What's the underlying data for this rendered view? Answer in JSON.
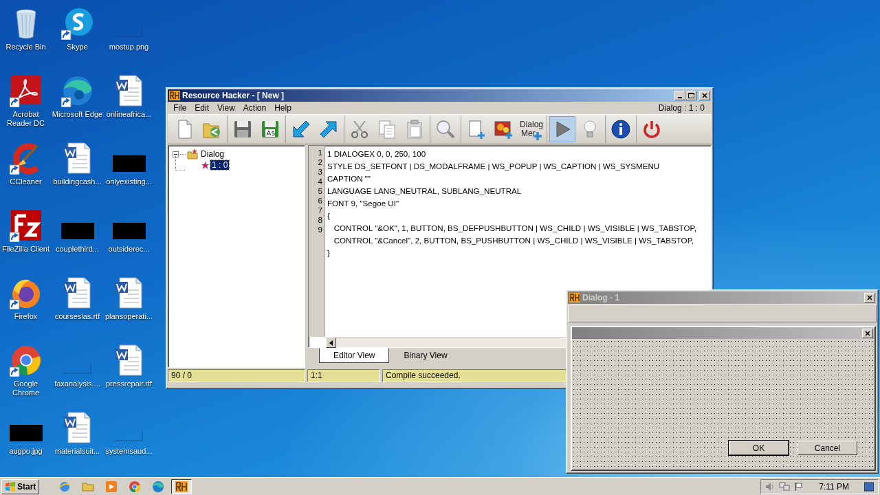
{
  "desktop_icons": [
    {
      "label": "Recycle Bin",
      "kind": "trash",
      "shortcut": false
    },
    {
      "label": "Skype",
      "kind": "chat",
      "shortcut": true
    },
    {
      "label": "mostup.png",
      "kind": "blank-thumbnail",
      "shortcut": false
    },
    {
      "label": "Acrobat Reader DC",
      "kind": "pdf",
      "shortcut": true
    },
    {
      "label": "Microsoft Edge",
      "kind": "wave",
      "shortcut": true
    },
    {
      "label": "onlineafrica...",
      "kind": "document",
      "shortcut": false
    },
    {
      "label": "CCleaner",
      "kind": "brush",
      "shortcut": true
    },
    {
      "label": "buildingcash...",
      "kind": "document",
      "shortcut": false
    },
    {
      "label": "onlyexisting...",
      "kind": "dark-thumbnail",
      "shortcut": false
    },
    {
      "label": "FileZilla Client",
      "kind": "zigzag",
      "shortcut": true
    },
    {
      "label": "couplethird...",
      "kind": "dark-thumbnail",
      "shortcut": false
    },
    {
      "label": "outsiderec...",
      "kind": "dark-thumbnail",
      "shortcut": false
    },
    {
      "label": "Firefox",
      "kind": "fox",
      "shortcut": true
    },
    {
      "label": "courseslas.rtf",
      "kind": "document",
      "shortcut": false
    },
    {
      "label": "plansoperati...",
      "kind": "document",
      "shortcut": false
    },
    {
      "label": "Google Chrome",
      "kind": "browser",
      "shortcut": true
    },
    {
      "label": "faxanalysis....",
      "kind": "blank-thumbnail",
      "shortcut": false
    },
    {
      "label": "pressrepair.rtf",
      "kind": "document",
      "shortcut": false
    },
    {
      "label": "augpo.jpg",
      "kind": "dark-thumbnail",
      "shortcut": false
    },
    {
      "label": "materialsuit...",
      "kind": "document",
      "shortcut": false
    },
    {
      "label": "systemsaud...",
      "kind": "blank-thumbnail",
      "shortcut": false
    }
  ],
  "main_window": {
    "title": "Resource Hacker - [ New ]",
    "menu": [
      "File",
      "Edit",
      "View",
      "Action",
      "Help"
    ],
    "context": "Dialog : 1 : 0",
    "toolbar": [
      [
        {
          "kind": "new",
          "selected": false
        },
        {
          "kind": "open",
          "selected": false
        }
      ],
      [
        {
          "kind": "save",
          "selected": false
        },
        {
          "kind": "save-as",
          "selected": false
        }
      ],
      [
        {
          "kind": "import",
          "selected": false
        },
        {
          "kind": "export",
          "selected": false
        }
      ],
      [
        {
          "kind": "cut",
          "selected": false
        },
        {
          "kind": "copy",
          "selected": false
        },
        {
          "kind": "paste",
          "selected": false
        }
      ],
      [
        {
          "kind": "find",
          "selected": false
        }
      ],
      [
        {
          "kind": "add-blank",
          "selected": false
        },
        {
          "kind": "add-image",
          "selected": false
        },
        {
          "kind": "merger",
          "selected": false,
          "lines": [
            "Dialog",
            "Mer"
          ]
        }
      ],
      [
        {
          "kind": "run",
          "selected": true
        },
        {
          "kind": "bulb",
          "selected": false
        }
      ],
      [
        {
          "kind": "info",
          "selected": false
        }
      ],
      [
        {
          "kind": "power",
          "selected": false
        }
      ]
    ],
    "tree": [
      {
        "label": "Dialog",
        "selected": false,
        "expanded": true,
        "children": [
          {
            "label": "1 : 0",
            "selected": true
          }
        ]
      }
    ],
    "code_lines": [
      {
        "number": "1",
        "text": "1 DIALOGEX 0, 0, 250, 100"
      },
      {
        "number": "2",
        "text": "STYLE DS_SETFONT | DS_MODALFRAME | WS_POPUP | WS_CAPTION | WS_SYSMENU"
      },
      {
        "number": "3",
        "text": "CAPTION \"\""
      },
      {
        "number": "4",
        "text": "LANGUAGE LANG_NEUTRAL, SUBLANG_NEUTRAL"
      },
      {
        "number": "5",
        "text": "FONT 9, \"Segoe UI\""
      },
      {
        "number": "6",
        "text": "{"
      },
      {
        "number": "7",
        "text": "   CONTROL \"&OK\", 1, BUTTON, BS_DEFPUSHBUTTON | WS_CHILD | WS_VISIBLE | WS_TABSTOP,"
      },
      {
        "number": "8",
        "text": "   CONTROL \"&Cancel\", 2, BUTTON, BS_PUSHBUTTON | WS_CHILD | WS_VISIBLE | WS_TABSTOP,"
      },
      {
        "number": "9",
        "text": "}"
      }
    ],
    "tabs": [
      {
        "label": "Editor View",
        "selected": true
      },
      {
        "label": "Binary View",
        "selected": false
      }
    ],
    "status_bar": [
      "90 / 0",
      "1:1",
      "Compile succeeded."
    ]
  },
  "preview_window": {
    "title": "Dialog - 1",
    "buttons": [
      {
        "label": "OK",
        "default": true
      },
      {
        "label": "Cancel",
        "default": false
      }
    ]
  },
  "taskbar": {
    "start": "Start",
    "apps": [
      {
        "kind": "globe",
        "active": false
      },
      {
        "kind": "folder",
        "active": false
      },
      {
        "kind": "media",
        "active": false
      },
      {
        "kind": "browser",
        "active": false
      },
      {
        "kind": "wave",
        "active": false
      },
      {
        "kind": "rh",
        "active": true
      }
    ],
    "clock": "7:11 PM"
  }
}
